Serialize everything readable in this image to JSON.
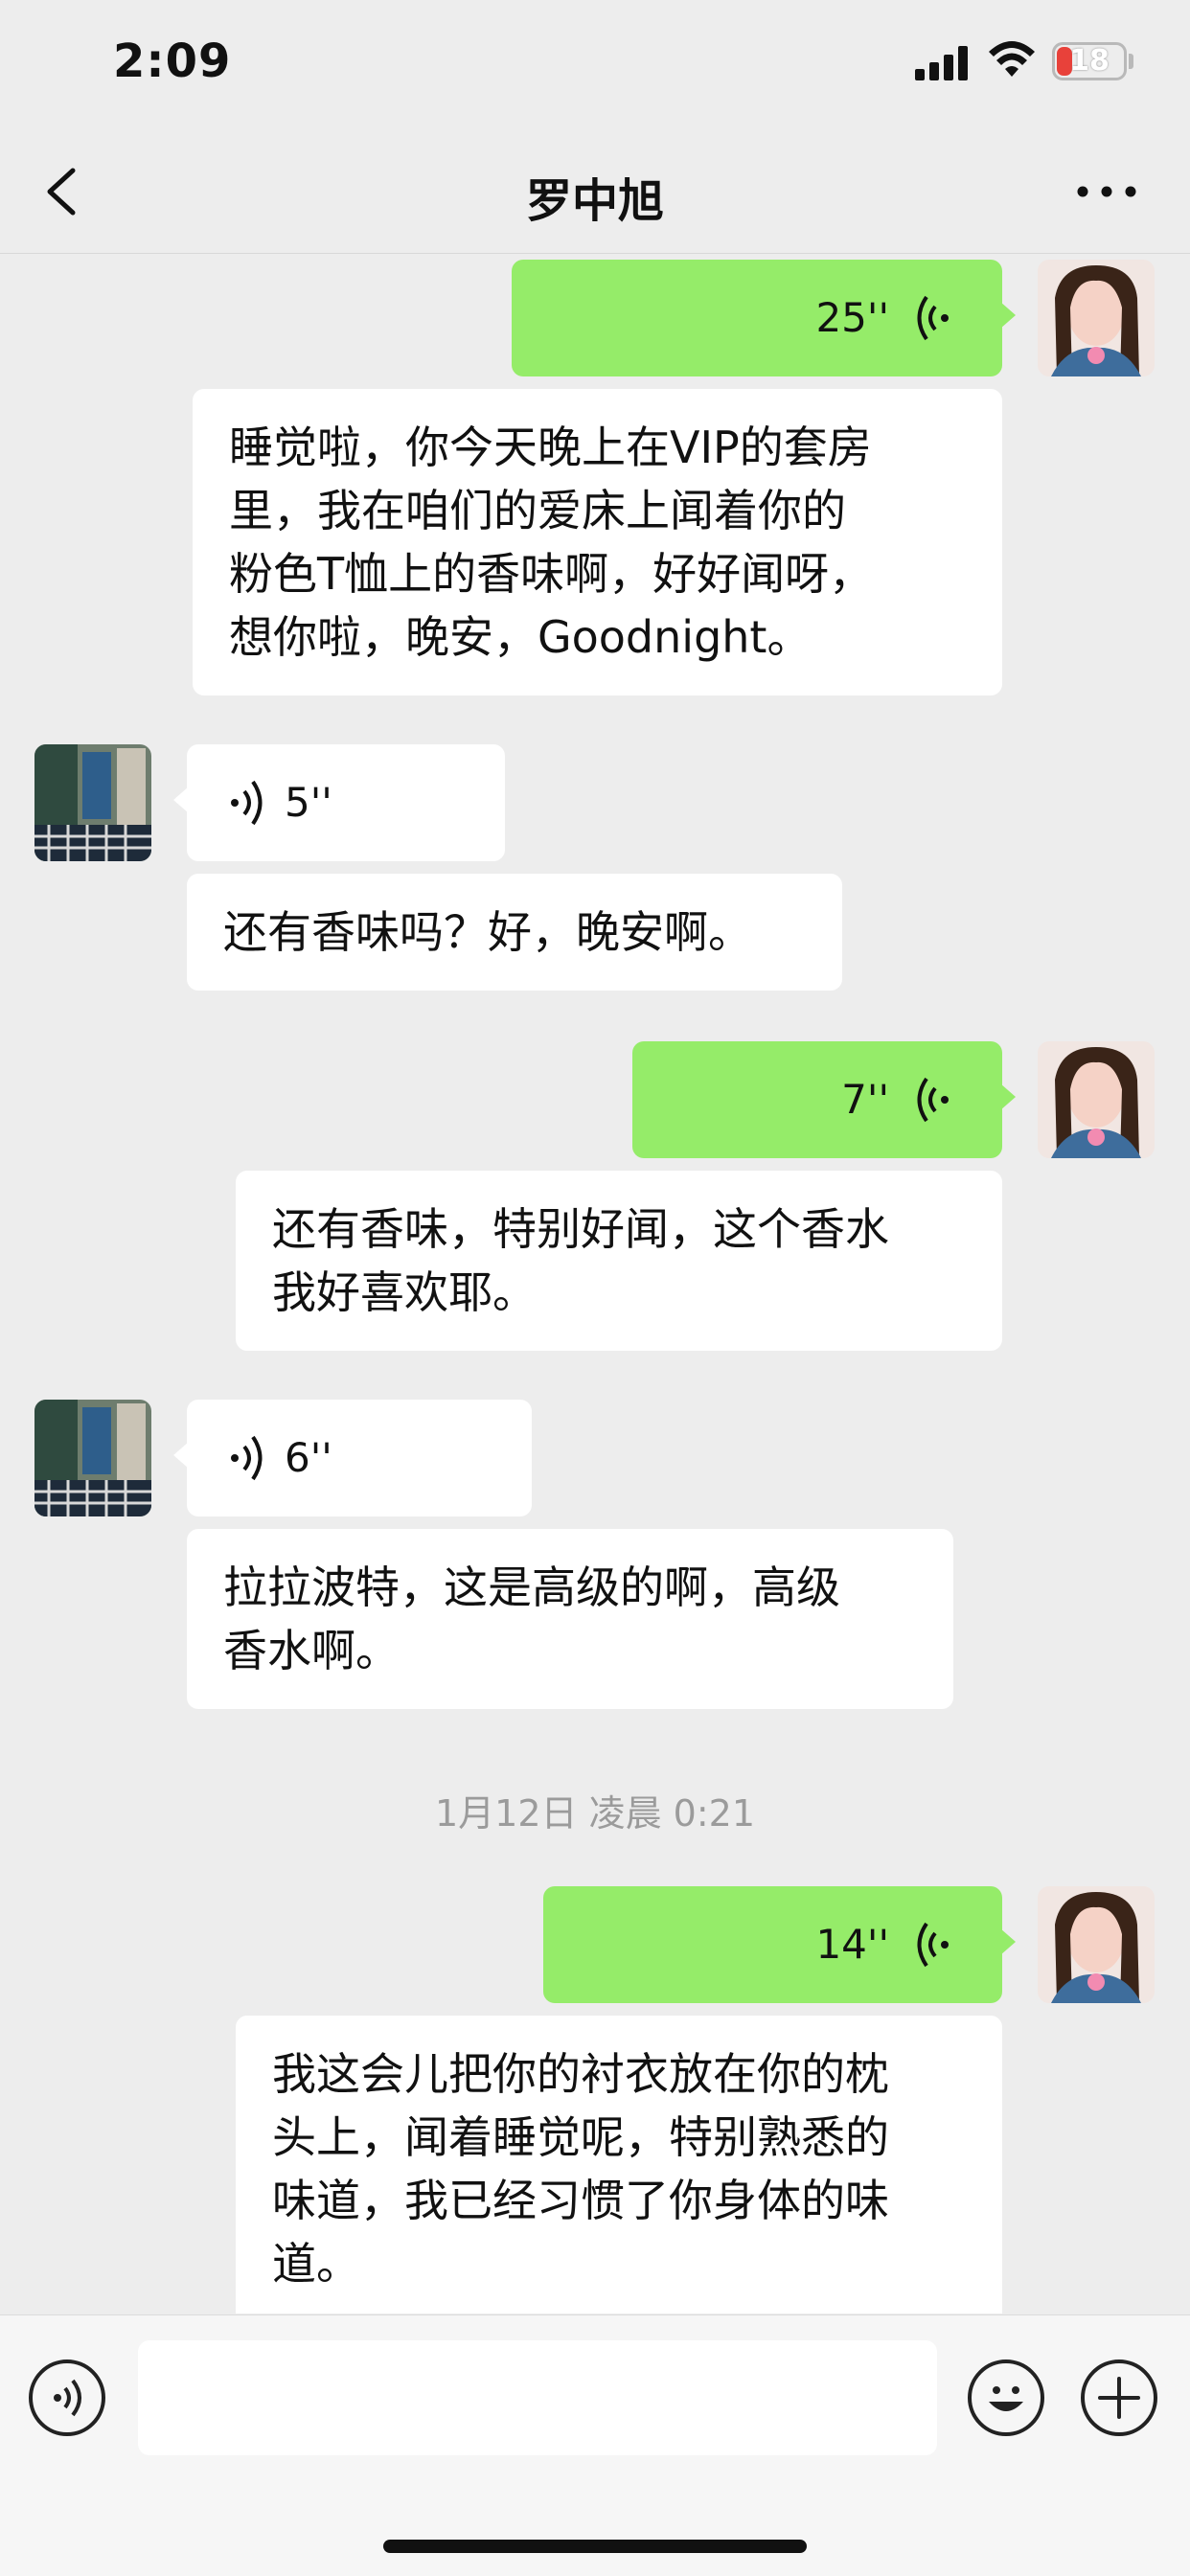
{
  "status_bar": {
    "time": "2:09",
    "battery": "18"
  },
  "header": {
    "title": "罗中旭"
  },
  "messages": [
    {
      "side": "right",
      "type": "voice",
      "duration": "25''"
    },
    {
      "side": "right",
      "type": "text",
      "text": "睡觉啦，你今天晚上在VIP的套房\n里，我在咱们的爱床上闻着你的\n粉色T恤上的香味啊，好好闻呀，\n想你啦，晚安，Goodnight。"
    },
    {
      "side": "left",
      "type": "voice",
      "duration": "5''"
    },
    {
      "side": "left",
      "type": "text",
      "text": "还有香味吗？好，晚安啊。"
    },
    {
      "side": "right",
      "type": "voice",
      "duration": "7''"
    },
    {
      "side": "right",
      "type": "text",
      "text": "还有香味，特别好闻，这个香水\n我好喜欢耶。"
    },
    {
      "side": "left",
      "type": "voice",
      "duration": "6''"
    },
    {
      "side": "left",
      "type": "text",
      "text": "拉拉波特，这是高级的啊，高级\n香水啊。"
    },
    {
      "side": "right",
      "type": "voice",
      "duration": "14''"
    },
    {
      "side": "right",
      "type": "text",
      "text": "我这会儿把你的衬衣放在你的枕\n头上，闻着睡觉呢，特别熟悉的\n味道，我已经习惯了你身体的味\n道。"
    }
  ],
  "timestamp": "1月12日 凌晨 0:21",
  "input_bar": {
    "placeholder": ""
  },
  "colors": {
    "bubble_sent": "#95EC69",
    "bubble_received": "#FFFFFF",
    "background": "#EDEDED"
  },
  "icons": {
    "back": "chevron-left-icon",
    "more": "more-dots-icon",
    "voice": "voice-icon",
    "emoji": "emoji-icon",
    "add": "plus-icon"
  }
}
